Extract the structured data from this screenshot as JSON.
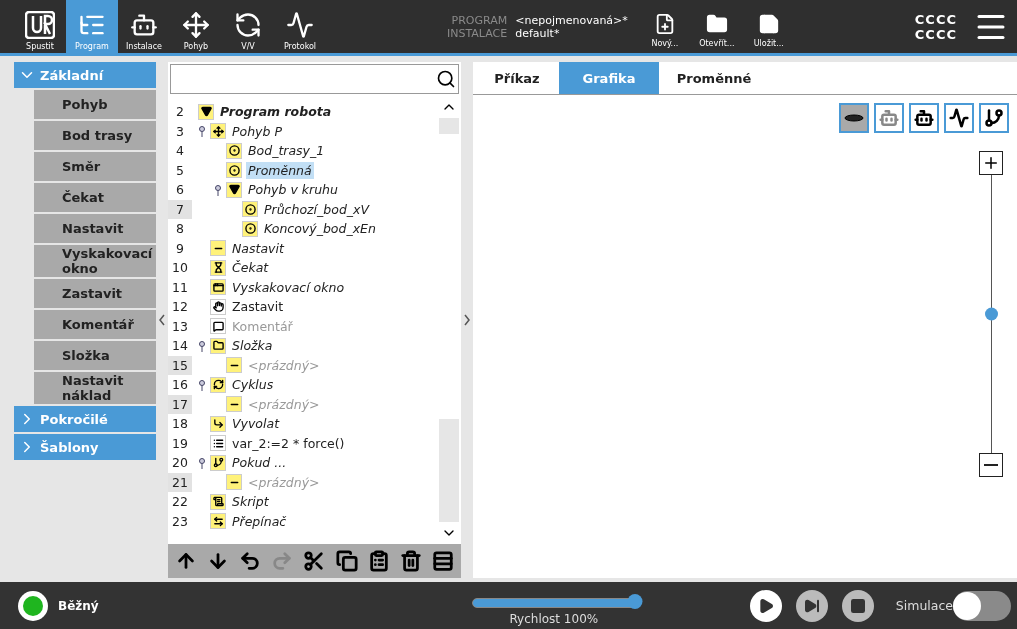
{
  "nav": [
    {
      "label": "Spustit",
      "kind": "logo",
      "selected": false
    },
    {
      "label": "Program",
      "kind": "program",
      "selected": true
    },
    {
      "label": "Instalace",
      "kind": "robot",
      "selected": false
    },
    {
      "label": "Pohyb",
      "kind": "move",
      "selected": false
    },
    {
      "label": "V/V",
      "kind": "io",
      "selected": false
    },
    {
      "label": "Protokol",
      "kind": "log",
      "selected": false
    }
  ],
  "file_info": [
    {
      "label": "PROGRAM",
      "value": "<nepojmenovaná>*"
    },
    {
      "label": "INSTALACE",
      "value": "default*"
    }
  ],
  "file_buttons": [
    {
      "label": "Nový...",
      "kind": "new"
    },
    {
      "label": "Otevřít...",
      "kind": "open"
    },
    {
      "label": "Uložit...",
      "kind": "save"
    }
  ],
  "user": [
    "CCCC",
    "CCCC"
  ],
  "categories": [
    {
      "label": "Základní",
      "expanded": true,
      "items": [
        "Pohyb",
        "Bod trasy",
        "Směr",
        "Čekat",
        "Nastavit",
        "Vyskakovací okno",
        "Zastavit",
        "Komentář",
        "Složka",
        "Nastavit náklad"
      ]
    },
    {
      "label": "Pokročilé",
      "expanded": false
    },
    {
      "label": "Šablony",
      "expanded": false
    }
  ],
  "tree": [
    {
      "line": "2",
      "label": "Program robota",
      "kind": "program",
      "bold": true,
      "italic": true,
      "disabled": false,
      "marked": false,
      "selected": false,
      "children": [
        {
          "line": "3",
          "label": "Pohyb P",
          "kind": "move",
          "italic": true,
          "disabled": false,
          "marked": false,
          "selected": false,
          "expanded": true,
          "children": [
            {
              "line": "4",
              "label": "Bod_trasy_1",
              "kind": "waypoint",
              "italic": true,
              "disabled": false,
              "marked": false,
              "selected": false
            },
            {
              "line": "5",
              "label": "Proměnná",
              "kind": "waypoint",
              "italic": true,
              "disabled": false,
              "marked": false,
              "selected": true
            },
            {
              "line": "6",
              "label": "Pohyb v kruhu",
              "kind": "program",
              "italic": true,
              "disabled": false,
              "marked": false,
              "selected": false,
              "expanded": true,
              "children": [
                {
                  "line": "7",
                  "label": "Průchozí_bod_xV",
                  "kind": "waypoint",
                  "italic": true,
                  "disabled": false,
                  "marked": true,
                  "selected": false
                },
                {
                  "line": "8",
                  "label": "Koncový_bod_xEn",
                  "kind": "waypoint",
                  "italic": true,
                  "disabled": false,
                  "marked": false,
                  "selected": false
                }
              ]
            }
          ]
        },
        {
          "line": "9",
          "label": "Nastavit",
          "kind": "set",
          "italic": true,
          "disabled": false,
          "marked": false,
          "selected": false
        },
        {
          "line": "10",
          "label": "Čekat",
          "kind": "wait",
          "italic": true,
          "disabled": false,
          "marked": false,
          "selected": false
        },
        {
          "line": "11",
          "label": "Vyskakovací okno",
          "kind": "popup",
          "italic": true,
          "disabled": false,
          "marked": false,
          "selected": false
        },
        {
          "line": "12",
          "label": "Zastavit",
          "kind": "halt",
          "italic": false,
          "disabled": false,
          "marked": false,
          "selected": false
        },
        {
          "line": "13",
          "label": "Komentář",
          "kind": "comment",
          "italic": false,
          "disabled": true,
          "marked": false,
          "selected": false
        },
        {
          "line": "14",
          "label": "Složka",
          "kind": "folder",
          "italic": true,
          "disabled": false,
          "marked": false,
          "selected": false,
          "expanded": true,
          "children": [
            {
              "line": "15",
              "label": "<prázdný>",
              "kind": "set",
              "italic": true,
              "disabled": true,
              "marked": true,
              "selected": false
            }
          ]
        },
        {
          "line": "16",
          "label": "Cyklus",
          "kind": "loop",
          "italic": true,
          "disabled": false,
          "marked": false,
          "selected": false,
          "expanded": true,
          "children": [
            {
              "line": "17",
              "label": "<prázdný>",
              "kind": "set",
              "italic": true,
              "disabled": true,
              "marked": true,
              "selected": false
            }
          ]
        },
        {
          "line": "18",
          "label": "Vyvolat",
          "kind": "call",
          "italic": true,
          "disabled": false,
          "marked": false,
          "selected": false
        },
        {
          "line": "19",
          "label": "var_2:=2 * force()",
          "kind": "assign",
          "italic": false,
          "disabled": false,
          "marked": false,
          "selected": false
        },
        {
          "line": "20",
          "label": "Pokud ...",
          "kind": "if",
          "italic": true,
          "disabled": false,
          "marked": false,
          "selected": false,
          "expanded": true,
          "children": [
            {
              "line": "21",
              "label": "<prázdný>",
              "kind": "set",
              "italic": true,
              "disabled": true,
              "marked": true,
              "selected": false
            }
          ]
        },
        {
          "line": "22",
          "label": "Skript",
          "kind": "script",
          "italic": true,
          "disabled": false,
          "marked": false,
          "selected": false
        },
        {
          "line": "23",
          "label": "Přepínač",
          "kind": "switch",
          "italic": true,
          "disabled": false,
          "marked": false,
          "selected": false
        }
      ]
    }
  ],
  "tree_tools": [
    {
      "kind": "up",
      "disabled": false
    },
    {
      "kind": "down",
      "disabled": false
    },
    {
      "kind": "undo",
      "disabled": false
    },
    {
      "kind": "redo",
      "disabled": true
    },
    {
      "kind": "cut",
      "disabled": false
    },
    {
      "kind": "copy",
      "disabled": false
    },
    {
      "kind": "paste",
      "disabled": false
    },
    {
      "kind": "delete",
      "disabled": false
    },
    {
      "kind": "suppress",
      "disabled": false
    }
  ],
  "tabs": [
    {
      "label": "Příkaz",
      "selected": false
    },
    {
      "label": "Grafika",
      "selected": true
    },
    {
      "label": "Proměnné",
      "selected": false
    }
  ],
  "view_buttons": [
    {
      "kind": "base",
      "selected": true
    },
    {
      "kind": "arm-grey",
      "selected": false
    },
    {
      "kind": "arm",
      "selected": false
    },
    {
      "kind": "path",
      "selected": false
    },
    {
      "kind": "points",
      "selected": false
    }
  ],
  "zoom": {
    "level": 0.5
  },
  "status": {
    "label": "Běžný",
    "color": "#1fb51f"
  },
  "speed": {
    "level": 1.0,
    "label": "Rychlost 100%"
  },
  "playback": [
    {
      "kind": "play",
      "disabled": false
    },
    {
      "kind": "step",
      "disabled": true
    },
    {
      "kind": "stop",
      "disabled": true
    }
  ],
  "simulation": {
    "label": "Simulace",
    "on": false
  }
}
